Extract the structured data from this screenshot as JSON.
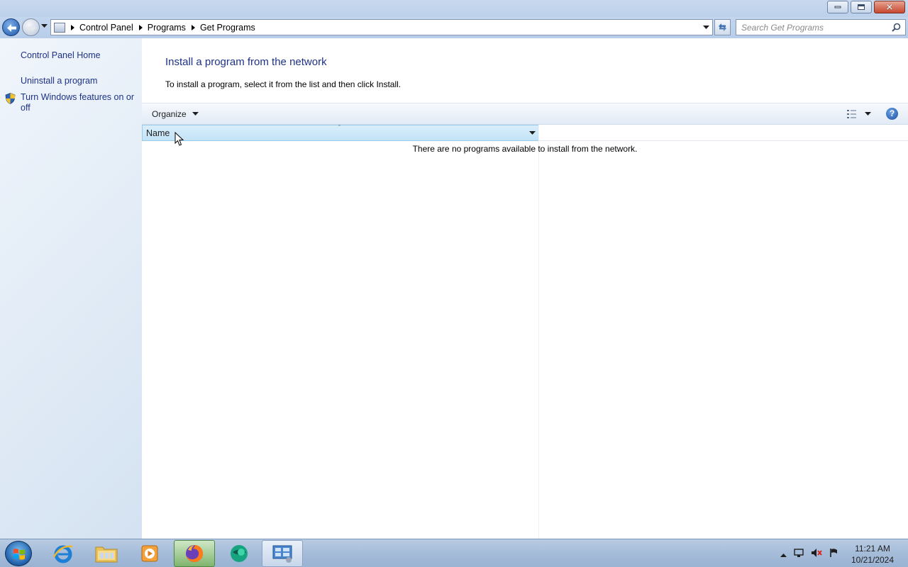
{
  "window": {
    "minimize_label": "Minimize",
    "maximize_label": "Restore",
    "close_label": "Close"
  },
  "address": {
    "crumbs": [
      "Control Panel",
      "Programs",
      "Get Programs"
    ]
  },
  "search": {
    "placeholder": "Search Get Programs"
  },
  "left_pane": {
    "links": [
      "Control Panel Home",
      "Uninstall a program",
      "Turn Windows features on or off"
    ]
  },
  "main": {
    "title": "Install a program from the network",
    "instructions": "To install a program, select it from the list and then click Install.",
    "toolbar": {
      "organize_label": "Organize"
    },
    "columns": [
      "Name"
    ],
    "empty_message": "There are no programs available to install from the network."
  },
  "taskbar": {
    "apps": [
      "Internet Explorer",
      "Windows Explorer",
      "Windows Media Player",
      "Firefox",
      "Browser",
      "Control Panel"
    ],
    "clock_time": "11:21 AM",
    "clock_date": "10/21/2024"
  },
  "colors": {
    "link": "#1e3287",
    "column_header_bg": "#c3e3f7",
    "taskbar": "#a5bcd9"
  }
}
